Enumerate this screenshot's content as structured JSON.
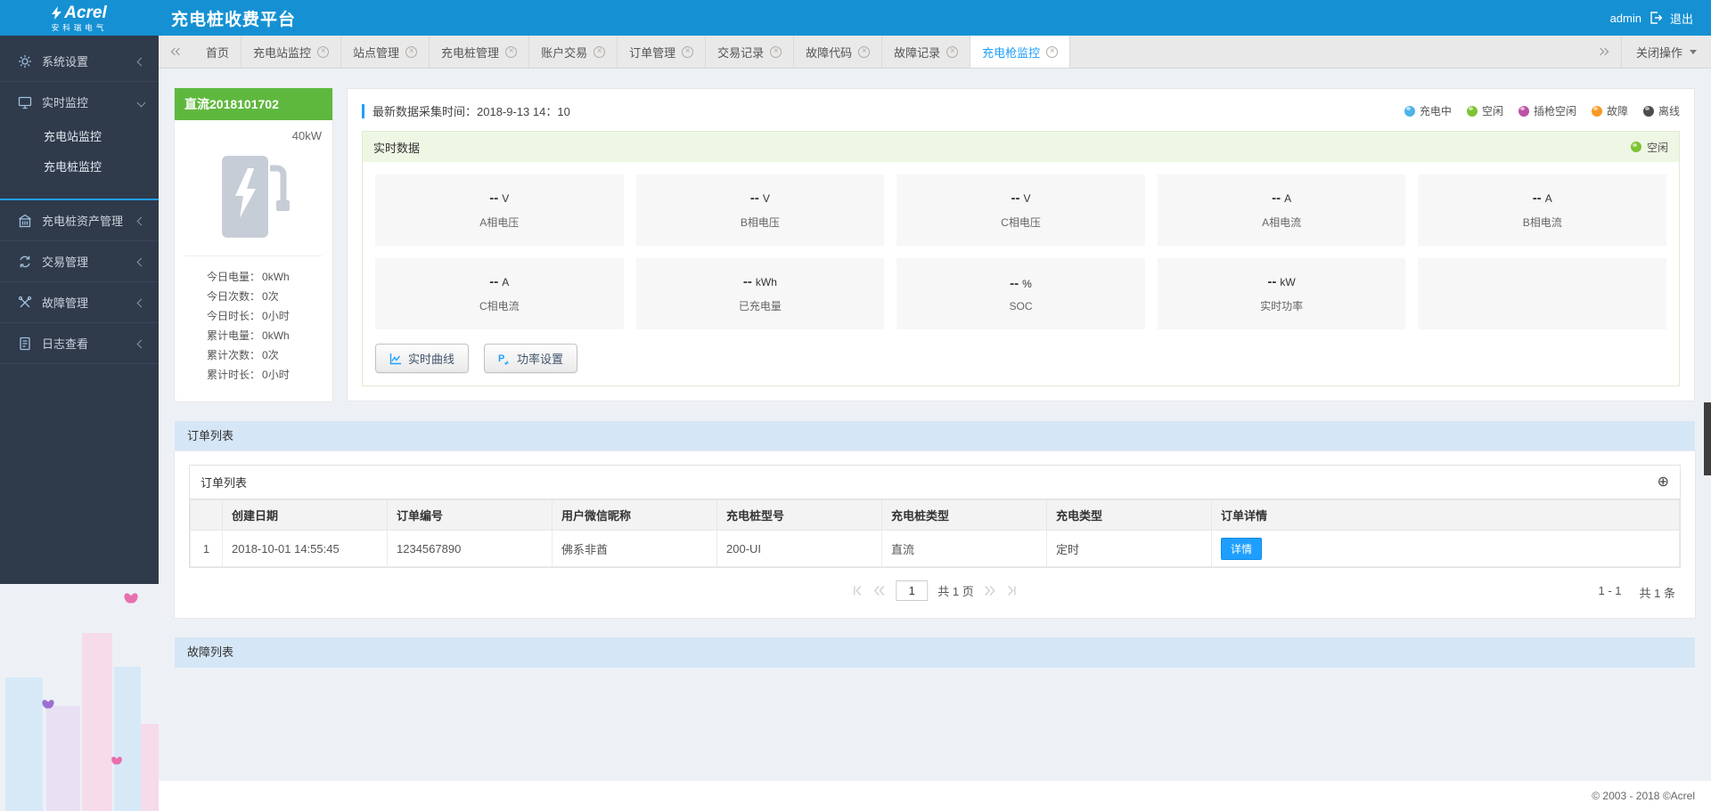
{
  "brand": {
    "logo": "Acrel",
    "logo_sub": "安科瑞电气",
    "app_title": "充电桩收费平台"
  },
  "header": {
    "username": "admin",
    "logout": "退出"
  },
  "sidebar": {
    "items": [
      {
        "label": "系统设置"
      },
      {
        "label": "实时监控"
      },
      {
        "label": "充电桩资产管理"
      },
      {
        "label": "交易管理"
      },
      {
        "label": "故障管理"
      },
      {
        "label": "日志查看"
      }
    ],
    "realtime_children": [
      {
        "label": "充电站监控"
      },
      {
        "label": "充电桩监控"
      }
    ]
  },
  "tabbar": {
    "tabs": [
      {
        "label": "首页"
      },
      {
        "label": "充电站监控"
      },
      {
        "label": "站点管理"
      },
      {
        "label": "充电桩管理"
      },
      {
        "label": "账户交易"
      },
      {
        "label": "订单管理"
      },
      {
        "label": "交易记录"
      },
      {
        "label": "故障代码"
      },
      {
        "label": "故障记录"
      },
      {
        "label": "充电枪监控"
      }
    ],
    "close_menu": "关闭操作"
  },
  "device": {
    "name": "直流2018101702",
    "power": "40kW",
    "stats": [
      {
        "label": "今日电量：",
        "value": "0kWh"
      },
      {
        "label": "今日次数：",
        "value": "0次"
      },
      {
        "label": "今日时长：",
        "value": "0小时"
      },
      {
        "label": "累计电量：",
        "value": "0kWh"
      },
      {
        "label": "累计次数：",
        "value": "0次"
      },
      {
        "label": "累计时长：",
        "value": "0小时"
      }
    ]
  },
  "monitor": {
    "collect_time": "最新数据采集时间：2018-9-13 14：10",
    "legend": [
      {
        "label": "充电中",
        "color": "#4cb4e7"
      },
      {
        "label": "空闲",
        "color": "#7ec234"
      },
      {
        "label": "插枪空闲",
        "color": "#bc53a3"
      },
      {
        "label": "故障",
        "color": "#f59a23"
      },
      {
        "label": "离线",
        "color": "#4d4d4d"
      }
    ],
    "panel_title": "实时数据",
    "status": "空闲",
    "metrics": [
      {
        "value": "--",
        "unit": "V",
        "label": "A相电压"
      },
      {
        "value": "--",
        "unit": "V",
        "label": "B相电压"
      },
      {
        "value": "--",
        "unit": "V",
        "label": "C相电压"
      },
      {
        "value": "--",
        "unit": "A",
        "label": "A相电流"
      },
      {
        "value": "--",
        "unit": "A",
        "label": "B相电流"
      },
      {
        "value": "--",
        "unit": "A",
        "label": "C相电流"
      },
      {
        "value": "--",
        "unit": "kWh",
        "label": "已充电量"
      },
      {
        "value": "--",
        "unit": "%",
        "label": "SOC"
      },
      {
        "value": "--",
        "unit": "kW",
        "label": "实时功率"
      }
    ],
    "actions": [
      {
        "label": "实时曲线"
      },
      {
        "label": "功率设置"
      }
    ]
  },
  "orders": {
    "section_title": "订单列表",
    "panel_title": "订单列表",
    "headers": [
      "",
      "创建日期",
      "订单编号",
      "用户微信昵称",
      "充电桩型号",
      "充电桩类型",
      "充电类型",
      "订单详情"
    ],
    "rows": [
      {
        "index": "1",
        "created": "2018-10-01 14:55:45",
        "order_no": "1234567890",
        "wechat_nick": "佛系非酋",
        "pile_model": "200-UI",
        "pile_type": "直流",
        "charge_type": "定时",
        "detail_label": "详情"
      }
    ],
    "pagination": {
      "page": "1",
      "pages_label": "共 1 页",
      "range_label": "1 - 1",
      "total_label": "共 1 条"
    }
  },
  "faults": {
    "section_title": "故障列表"
  },
  "footer": {
    "copyright": "© 2003 - 2018 ©Acrel"
  }
}
